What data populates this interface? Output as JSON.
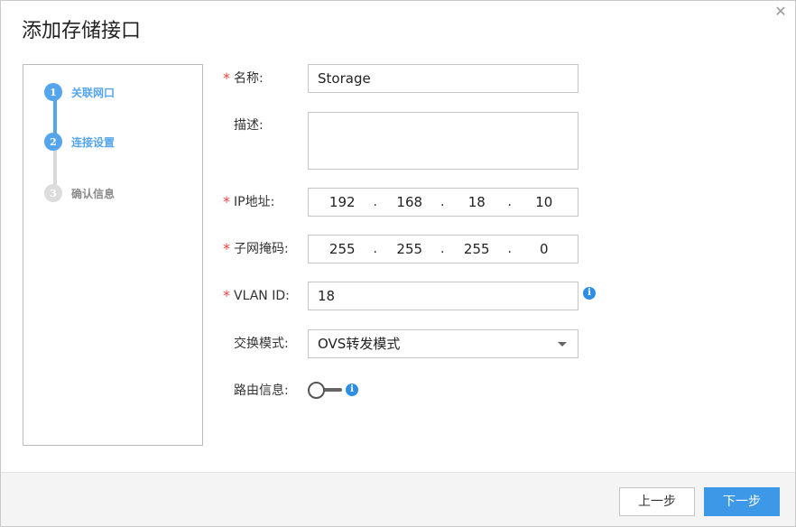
{
  "dialog": {
    "title": "添加存储接口",
    "close_glyph": "✕"
  },
  "steps": [
    {
      "num": "1",
      "label": "关联网口",
      "state": "done"
    },
    {
      "num": "2",
      "label": "连接设置",
      "state": "active"
    },
    {
      "num": "3",
      "label": "确认信息",
      "state": "pending"
    }
  ],
  "form": {
    "required_mark": "*",
    "name": {
      "label": "名称:",
      "value": "Storage"
    },
    "description": {
      "label": "描述:",
      "value": ""
    },
    "ip": {
      "label": "IP地址:",
      "segments": [
        "192",
        "168",
        "18",
        "10"
      ]
    },
    "mask": {
      "label": "子网掩码:",
      "segments": [
        "255",
        "255",
        "255",
        "0"
      ]
    },
    "vlan": {
      "label": "VLAN ID:",
      "value": "18"
    },
    "switch_mode": {
      "label": "交换模式:",
      "value": "OVS转发模式"
    },
    "route": {
      "label": "路由信息:",
      "enabled": false
    },
    "info_glyph": "i",
    "ip_separator": "."
  },
  "footer": {
    "prev_label": "上一步",
    "next_label": "下一步"
  },
  "colors": {
    "accent": "#55a5ee",
    "primary_button": "#3d98e8",
    "required": "#e84040",
    "info": "#2e8ee4"
  }
}
